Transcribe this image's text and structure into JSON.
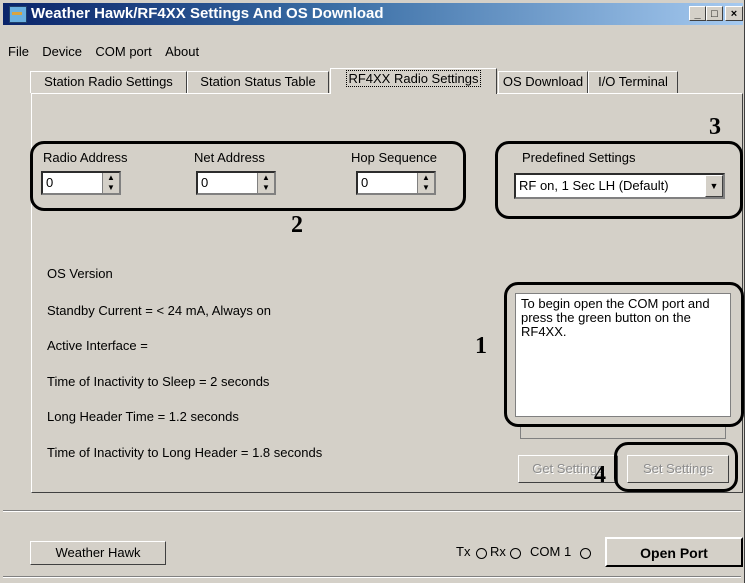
{
  "window": {
    "title": "Weather Hawk/RF4XX Settings And  OS Download",
    "minimize": "_",
    "maximize": "□",
    "close": "×"
  },
  "menu": {
    "file": "File",
    "device": "Device",
    "com_port": "COM port",
    "about": "About"
  },
  "tabs": [
    {
      "label": "Station Radio Settings"
    },
    {
      "label": "Station Status Table"
    },
    {
      "label": "RF4XX Radio Settings"
    },
    {
      "label": "OS Download"
    },
    {
      "label": "I/O Terminal"
    }
  ],
  "radio": {
    "radio_address_label": "Radio Address",
    "radio_address_value": "0",
    "net_address_label": "Net Address",
    "net_address_value": "0",
    "hop_sequence_label": "Hop Sequence",
    "hop_sequence_value": "0"
  },
  "predefined": {
    "label": "Predefined Settings",
    "value": "RF on, 1 Sec LH (Default)"
  },
  "info": {
    "os_version": "OS Version",
    "standby_current": "Standby Current = < 24 mA, Always on",
    "active_interface": "Active Interface =",
    "inactivity_sleep": "Time of Inactivity to Sleep = 2 seconds",
    "long_header_time": "Long Header Time = 1.2 seconds",
    "inactivity_long_header": "Time of Inactivity to Long Header = 1.8 seconds"
  },
  "instructions": "To begin open the COM port and press the green button on the RF4XX.",
  "buttons": {
    "get_settings": "Get Settings",
    "set_settings": "Set Settings",
    "weather_hawk": "Weather Hawk",
    "open_port": "Open Port"
  },
  "status": {
    "tx": "Tx",
    "rx": "Rx",
    "com": "COM 1"
  },
  "callouts": {
    "one": "1",
    "two": "2",
    "three": "3",
    "four": "4"
  }
}
